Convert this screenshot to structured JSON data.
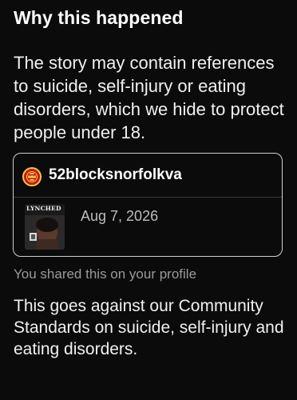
{
  "section": {
    "heading": "Why this happened",
    "explanation": "The story may contain references to suicide, self-injury or eating disorders, which we hide to protect people under 18."
  },
  "story_card": {
    "username": "52blocksnorfolkva",
    "avatar_icon": "red-circular-logo-badge",
    "thumbnail": {
      "caption": "LYNCHED",
      "icon": "story-thumbnail-image"
    },
    "date": "Aug 7, 2026"
  },
  "shared_note": "You shared this on your profile",
  "policy_text": "This goes against our Community Standards on suicide, self-injury and eating disorders.",
  "colors": {
    "background": "#0b0b0b",
    "text_primary": "#ffffff",
    "text_secondary": "#9a9a9a",
    "card_border": "#cfcfcf",
    "avatar_red": "#c41a15",
    "avatar_gold": "#f2c744"
  }
}
